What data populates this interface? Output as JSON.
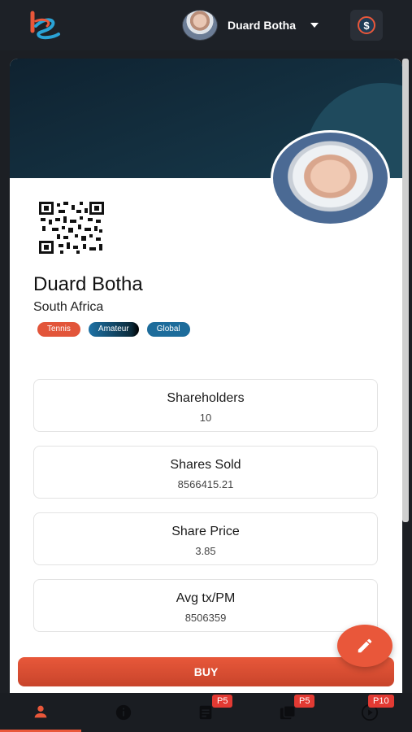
{
  "header": {
    "user_name": "Duard Botha",
    "logo_icon": "logo-icon",
    "coin_icon": "dollar-coin-icon"
  },
  "profile": {
    "name": "Duard Botha",
    "country": "South Africa",
    "tags": [
      "Tennis",
      "Amateur",
      "Global"
    ]
  },
  "stats": [
    {
      "label": "Shareholders",
      "value": "10"
    },
    {
      "label": "Shares Sold",
      "value": "8566415.21"
    },
    {
      "label": "Share Price",
      "value": "3.85"
    },
    {
      "label": "Avg tx/PM",
      "value": "8506359"
    }
  ],
  "actions": {
    "buy_label": "BUY",
    "edit_icon": "pencil-icon"
  },
  "bottom_nav": [
    {
      "icon": "person-icon",
      "badge": ""
    },
    {
      "icon": "info-icon",
      "badge": ""
    },
    {
      "icon": "document-icon",
      "badge": "P5"
    },
    {
      "icon": "portfolio-icon",
      "badge": "P5"
    },
    {
      "icon": "play-icon",
      "badge": "P10"
    }
  ],
  "colors": {
    "accent": "#e9573a",
    "topbar": "#1d2127",
    "banner": "#0f2230"
  }
}
